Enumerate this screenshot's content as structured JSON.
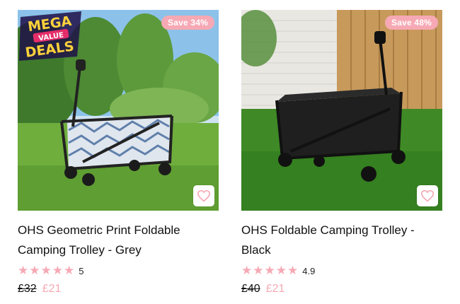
{
  "colors": {
    "accent": "#f6a9b4",
    "text": "#111111"
  },
  "products": [
    {
      "badge": "Save 34%",
      "promo": {
        "line1": "MEGA",
        "line2": "VALUE",
        "line3": "DEALS"
      },
      "title": "OHS Geometric Print Foldable Camping Trolley - Grey",
      "rating": {
        "stars": 5,
        "value": "5"
      },
      "price": {
        "was": "£32",
        "now": "£21"
      },
      "icons": [
        "heart-icon",
        "star-icon"
      ]
    },
    {
      "badge": "Save 48%",
      "title": "OHS Foldable Camping Trolley - Black",
      "rating": {
        "stars": 5,
        "value": "4.9"
      },
      "price": {
        "was": "£40",
        "now": "£21"
      },
      "icons": [
        "heart-icon",
        "star-icon"
      ]
    }
  ]
}
